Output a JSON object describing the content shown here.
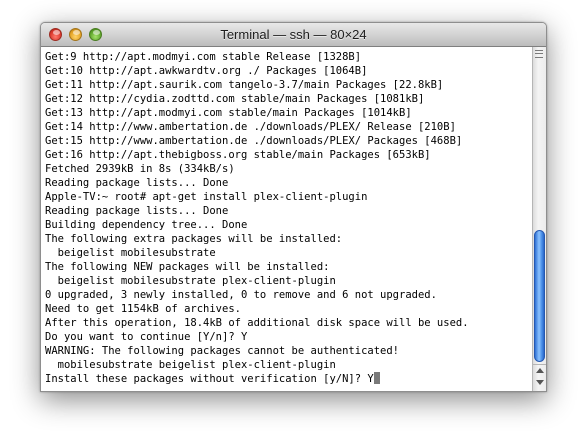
{
  "window": {
    "title": "Terminal — ssh — 80×24"
  },
  "terminal": {
    "lines": [
      "Get:9 http://apt.modmyi.com stable Release [1328B]",
      "Get:10 http://apt.awkwardtv.org ./ Packages [1064B]",
      "Get:11 http://apt.saurik.com tangelo-3.7/main Packages [22.8kB]",
      "Get:12 http://cydia.zodttd.com stable/main Packages [1081kB]",
      "Get:13 http://apt.modmyi.com stable/main Packages [1014kB]",
      "Get:14 http://www.ambertation.de ./downloads/PLEX/ Release [210B]",
      "Get:15 http://www.ambertation.de ./downloads/PLEX/ Packages [468B]",
      "Get:16 http://apt.thebigboss.org stable/main Packages [653kB]",
      "Fetched 2939kB in 8s (334kB/s)",
      "Reading package lists... Done",
      "Apple-TV:~ root# apt-get install plex-client-plugin",
      "Reading package lists... Done",
      "Building dependency tree... Done",
      "The following extra packages will be installed:",
      "  beigelist mobilesubstrate",
      "The following NEW packages will be installed:",
      "  beigelist mobilesubstrate plex-client-plugin",
      "0 upgraded, 3 newly installed, 0 to remove and 6 not upgraded.",
      "Need to get 1154kB of archives.",
      "After this operation, 18.4kB of additional disk space will be used.",
      "Do you want to continue [Y/n]? Y",
      "WARNING: The following packages cannot be authenticated!",
      "  mobilesubstrate beigelist plex-client-plugin",
      "Install these packages without verification [y/N]? Y"
    ]
  },
  "scrollbar": {
    "position_fraction": 0.7
  },
  "colors": {
    "text": "#000000",
    "background": "#ffffff",
    "scroll_thumb": "#4a8fe8",
    "close": "#d9352a",
    "minimize": "#e2a022",
    "zoom": "#5da32a"
  },
  "icons": {
    "close": "close-icon",
    "minimize": "minimize-icon",
    "zoom": "zoom-icon",
    "split": "split-pane-icon",
    "scroll_up": "arrow-up-icon",
    "scroll_down": "arrow-down-icon"
  }
}
